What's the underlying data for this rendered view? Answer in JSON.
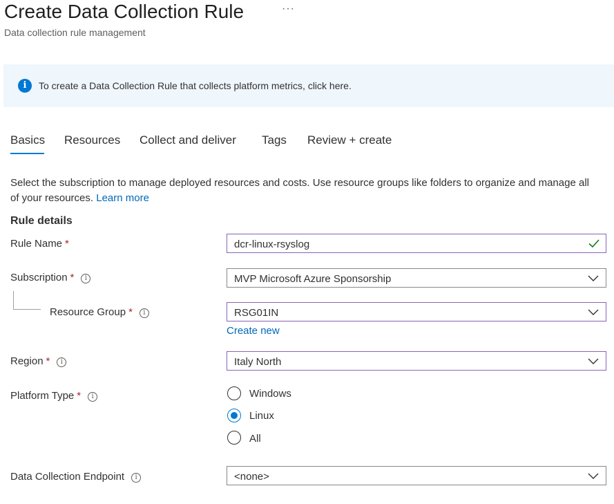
{
  "header": {
    "title": "Create Data Collection Rule",
    "more_label": "···",
    "subtitle": "Data collection rule management"
  },
  "banner": {
    "icon": "info-icon",
    "text": "To create a Data Collection Rule that collects platform metrics, click here."
  },
  "tabs": [
    {
      "label": "Basics",
      "active": true
    },
    {
      "label": "Resources"
    },
    {
      "label": "Collect and deliver"
    },
    {
      "label": "Tags"
    },
    {
      "label": "Review + create"
    }
  ],
  "intro": {
    "text": "Select the subscription to manage deployed resources and costs. Use resource groups like folders to organize and manage all of your resources.",
    "link": "Learn more"
  },
  "section_title": "Rule details",
  "form": {
    "rule_name": {
      "label": "Rule Name",
      "required": "*",
      "value": "dcr-linux-rsyslog"
    },
    "subscription": {
      "label": "Subscription",
      "required": "*",
      "value": "MVP Microsoft Azure Sponsorship"
    },
    "resource_group": {
      "label": "Resource Group",
      "required": "*",
      "value": "RSG01IN",
      "create_new": "Create new"
    },
    "region": {
      "label": "Region",
      "required": "*",
      "value": "Italy North"
    },
    "platform_type": {
      "label": "Platform Type",
      "required": "*",
      "options": [
        "Windows",
        "Linux",
        "All"
      ],
      "selected": "Linux"
    },
    "endpoint": {
      "label": "Data Collection Endpoint",
      "value": "<none>"
    }
  },
  "colors": {
    "accent": "#0078d4",
    "focus_border": "#8764b8",
    "valid": "#107c10",
    "required": "#a4262c"
  }
}
